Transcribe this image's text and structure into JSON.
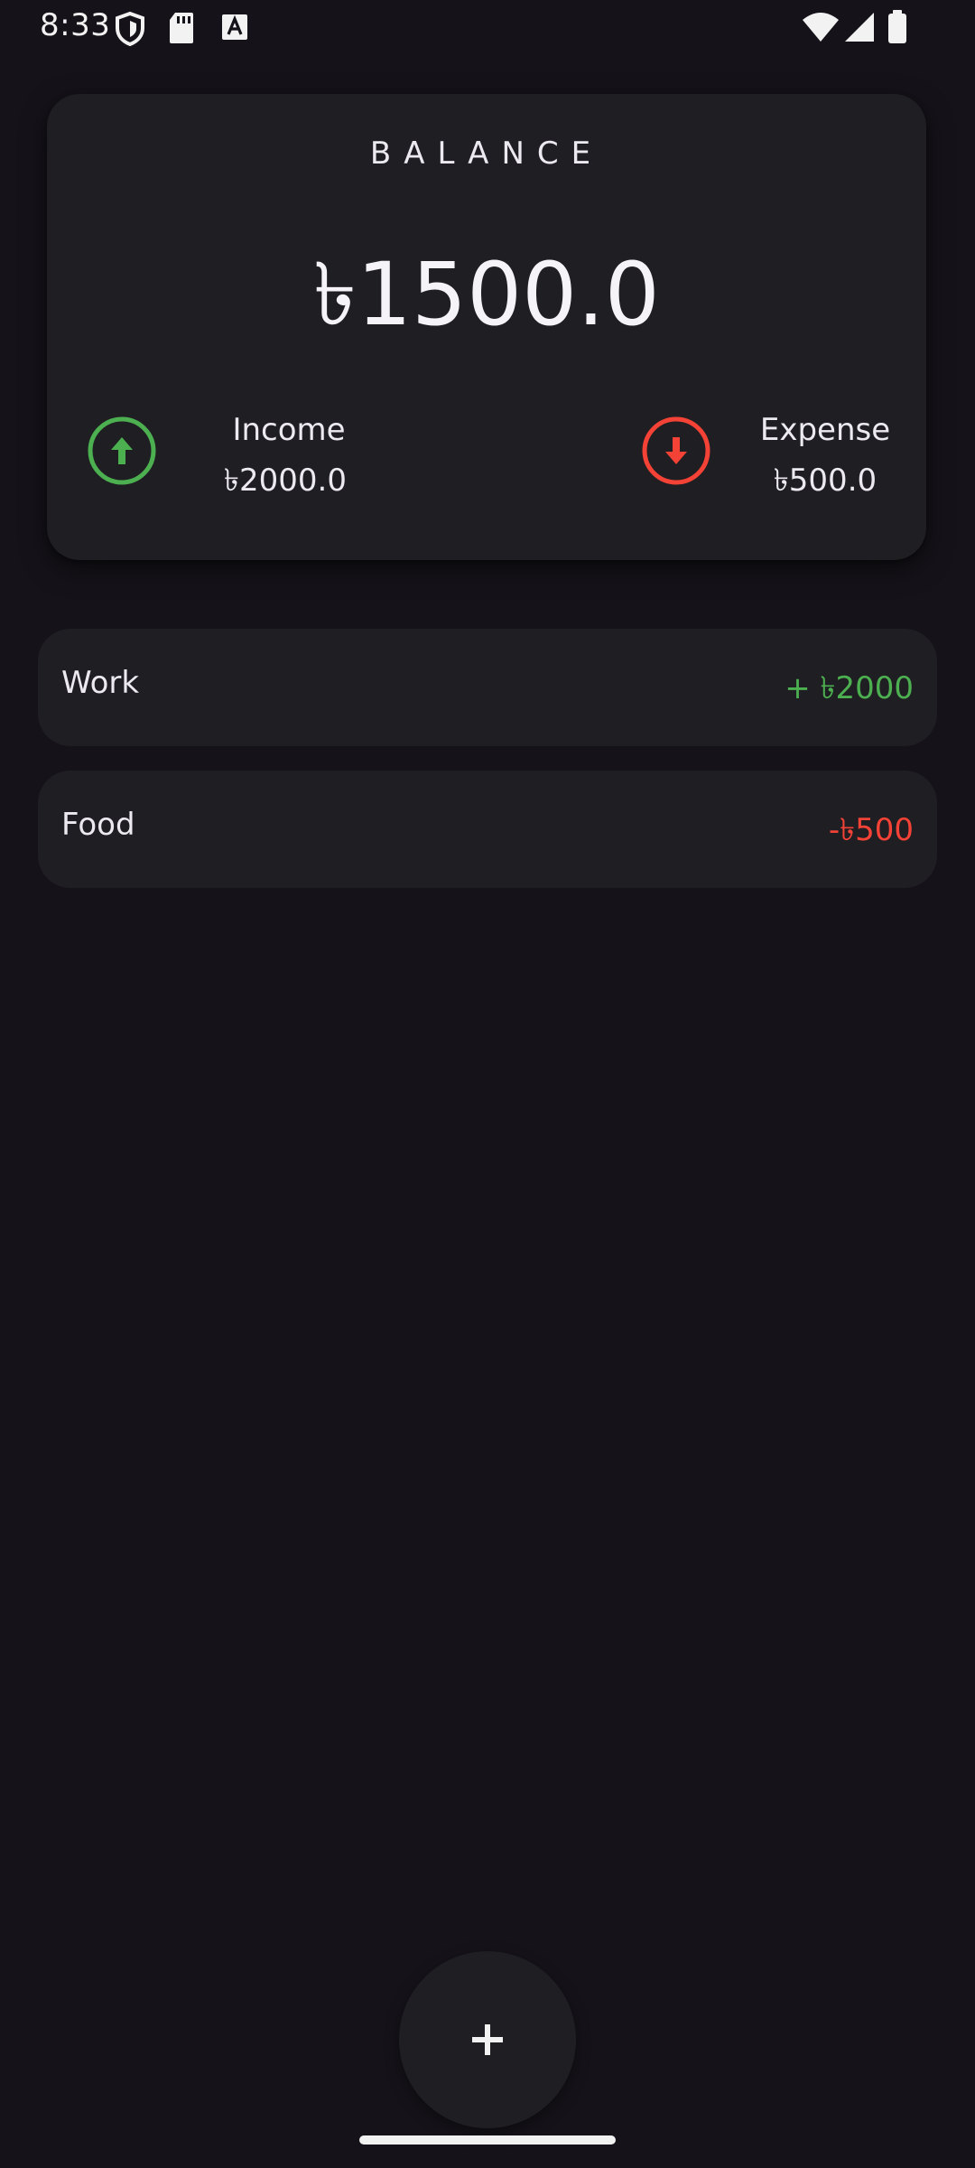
{
  "status_bar": {
    "time": "8:33",
    "icons": [
      "vpn-shield-icon",
      "sd-card-icon",
      "text-a-icon",
      "wifi-icon",
      "cellular-signal-icon",
      "battery-icon"
    ]
  },
  "colors": {
    "background": "#151319",
    "card": "#1F1E22",
    "income": "#4CAF50",
    "expense": "#F44336",
    "text": "#ECEAF0"
  },
  "balance_card": {
    "title": "BALANCE",
    "amount": "৳1500.0",
    "income": {
      "label": "Income",
      "value": "৳2000.0",
      "icon": "arrow-up-circle-icon"
    },
    "expense": {
      "label": "Expense",
      "value": "৳500.0",
      "icon": "arrow-down-circle-icon"
    }
  },
  "transactions": [
    {
      "name": "Work",
      "amount": "+ ৳2000",
      "type": "income"
    },
    {
      "name": "Food",
      "amount": "-৳500",
      "type": "expense"
    }
  ],
  "fab": {
    "icon": "plus-icon"
  }
}
